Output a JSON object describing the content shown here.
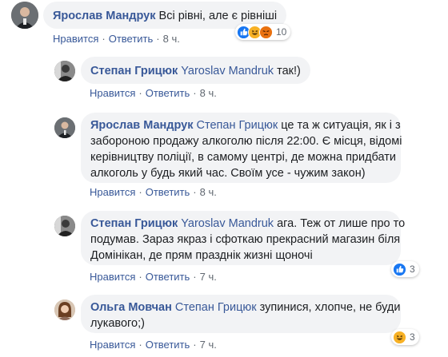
{
  "comments": [
    {
      "author": "Ярослав Мандрук",
      "mention": "",
      "text": "Всі рівні, але є рівніші",
      "like_label": "Нравится",
      "reply_label": "Ответить",
      "time": "8 ч.",
      "reactions": {
        "count": "10",
        "icons": [
          "like-icon",
          "haha-icon",
          "angry-icon"
        ]
      }
    },
    {
      "author": "Степан Грицюк",
      "mention": "Yaroslav Mandruk",
      "text": "так!)",
      "like_label": "Нравится",
      "reply_label": "Ответить",
      "time": "8 ч."
    },
    {
      "author": "Ярослав Мандрук",
      "mention": "Степан Грицюк",
      "text_line1": "це та ж ситуація, як і з",
      "text_line2": "забороною продажу алкоголю після 22:00. Є місця, відомі",
      "text_line3": "керівництву поліції, в самому центрі, де можна придбати",
      "text_line4": "алкоголь у будь який час. Своїм усе - чужим закон)",
      "like_label": "Нравится",
      "reply_label": "Ответить",
      "time": "8 ч."
    },
    {
      "author": "Степан Грицюк",
      "mention": "Yaroslav Mandruk",
      "text_line1": "ага. Теж от лише про то",
      "text_line2": "подумав. Зараз якраз і сфоткаю прекрасний магазин біля",
      "text_line3": "Домінікан, де прям празднік жизні щоночі",
      "like_label": "Нравится",
      "reply_label": "Ответить",
      "time": "7 ч.",
      "reactions": {
        "count": "3",
        "icons": [
          "like-icon"
        ]
      }
    },
    {
      "author": "Ольга Мовчан",
      "mention": "Степан Грицюк",
      "text_line1": "зупинися, хлопче, не буди",
      "text_line2": "лукавого;)",
      "like_label": "Нравится",
      "reply_label": "Ответить",
      "time": "7 ч.",
      "reactions": {
        "count": "3",
        "icons": [
          "haha-icon"
        ]
      }
    }
  ],
  "colors": {
    "author": "#385898",
    "bubble": "#f2f3f5",
    "meta": "#606770",
    "like_blue": "#1877f2",
    "angry": "#e9710f",
    "haha": "#f7b125"
  }
}
